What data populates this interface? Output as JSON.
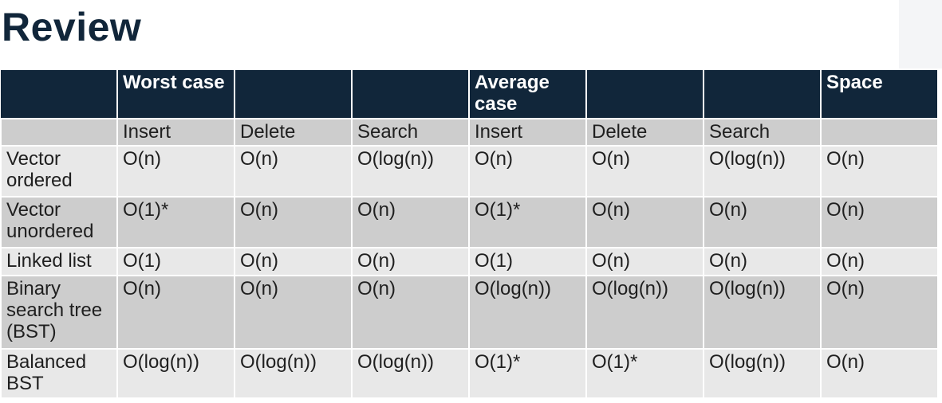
{
  "title": "Review",
  "table": {
    "group_headers": [
      "",
      "Worst case",
      "",
      "",
      "Average case",
      "",
      "",
      "Space"
    ],
    "sub_headers": [
      "",
      "Insert",
      "Delete",
      "Search",
      "Insert",
      "Delete",
      "Search",
      ""
    ],
    "rows": [
      {
        "name": "Vector ordered",
        "cells": [
          "O(n)",
          "O(n)",
          "O(log(n))",
          "O(n)",
          "O(n)",
          "O(log(n))",
          "O(n)"
        ]
      },
      {
        "name": "Vector unordered",
        "cells": [
          "O(1)*",
          "O(n)",
          "O(n)",
          "O(1)*",
          "O(n)",
          "O(n)",
          "O(n)"
        ]
      },
      {
        "name": "Linked list",
        "cells": [
          "O(1)",
          "O(n)",
          "O(n)",
          "O(1)",
          "O(n)",
          "O(n)",
          "O(n)"
        ]
      },
      {
        "name": "Binary search tree (BST)",
        "cells": [
          "O(n)",
          "O(n)",
          "O(n)",
          "O(log(n))",
          "O(log(n))",
          "O(log(n))",
          "O(n)"
        ]
      },
      {
        "name": "Balanced BST",
        "cells": [
          "O(log(n))",
          "O(log(n))",
          "O(log(n))",
          "O(1)*",
          "O(1)*",
          "O(log(n))",
          "O(n)"
        ]
      }
    ]
  }
}
